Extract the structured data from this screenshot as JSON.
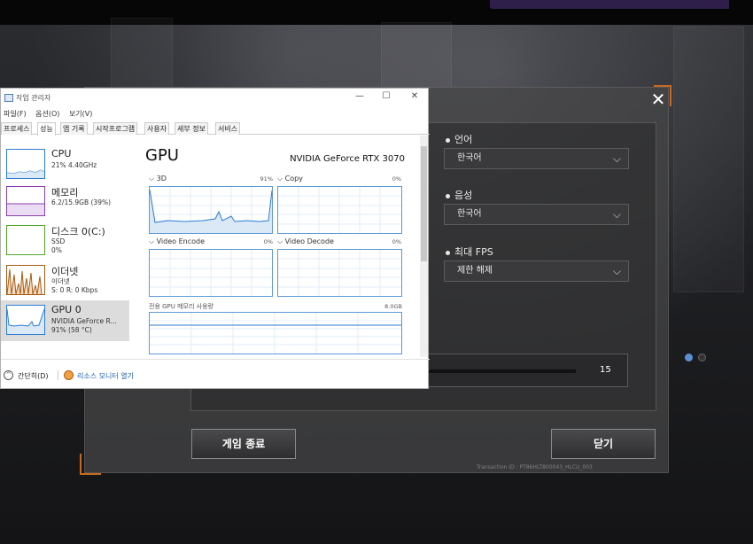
{
  "game": {
    "close_symbol": "✕",
    "settings": [
      {
        "label": "언어",
        "value": "한국어"
      },
      {
        "label": "음성",
        "value": "한국어"
      },
      {
        "label": "최대 FPS",
        "value": "제한 해제"
      }
    ],
    "slider_value": "15",
    "quit_button": "게임 종료",
    "close_button": "닫기",
    "transaction": "Transaction ID : PT86HLT800043_HLCU_003",
    "colors": {
      "accent": "#c86a1e",
      "panel": "#464648",
      "page_dot_active": "#5b8fd6",
      "page_dot_inactive": "#333333"
    }
  },
  "taskmanager": {
    "title": "작업 관리자",
    "window_controls": [
      "—",
      "☐",
      "✕"
    ],
    "menu": [
      "파일(F)",
      "옵션(O)",
      "보기(V)"
    ],
    "tabs": [
      "프로세스",
      "성능",
      "앱 기록",
      "시작프로그램",
      "사용자",
      "세부 정보",
      "서비스"
    ],
    "active_tab": "성능",
    "sidebar": [
      {
        "title": "CPU",
        "sub1": "21% 4.40GHz",
        "sub2": "",
        "color": "#2b7cd3"
      },
      {
        "title": "메모리",
        "sub1": "6.2/15.9GB (39%)",
        "sub2": "",
        "color": "#8b3fb0"
      },
      {
        "title": "디스크 0(C:)",
        "sub1": "SSD",
        "sub2": "0%",
        "color": "#4ea72c"
      },
      {
        "title": "이더넷",
        "sub1": "이더넷",
        "sub2": "S: 0 R: 0 Kbps",
        "color": "#a85b12"
      },
      {
        "title": "GPU 0",
        "sub1": "NVIDIA GeForce R...",
        "sub2": "91% (58 °C)",
        "color": "#2b7cd3"
      }
    ],
    "main": {
      "heading": "GPU",
      "device": "NVIDIA GeForce RTX 3070",
      "engines": [
        {
          "name": "3D",
          "pct": "91%"
        },
        {
          "name": "Copy",
          "pct": "0%"
        },
        {
          "name": "Video Encode",
          "pct": "0%"
        },
        {
          "name": "Video Decode",
          "pct": "0%"
        }
      ],
      "dedicated_memory_label": "전용 GPU 메모리 사용량",
      "dedicated_memory_max": "8.0GB"
    },
    "footer": {
      "fewer_details": "간단히(D)",
      "resource_monitor": "리소스 모니터 열기"
    }
  }
}
